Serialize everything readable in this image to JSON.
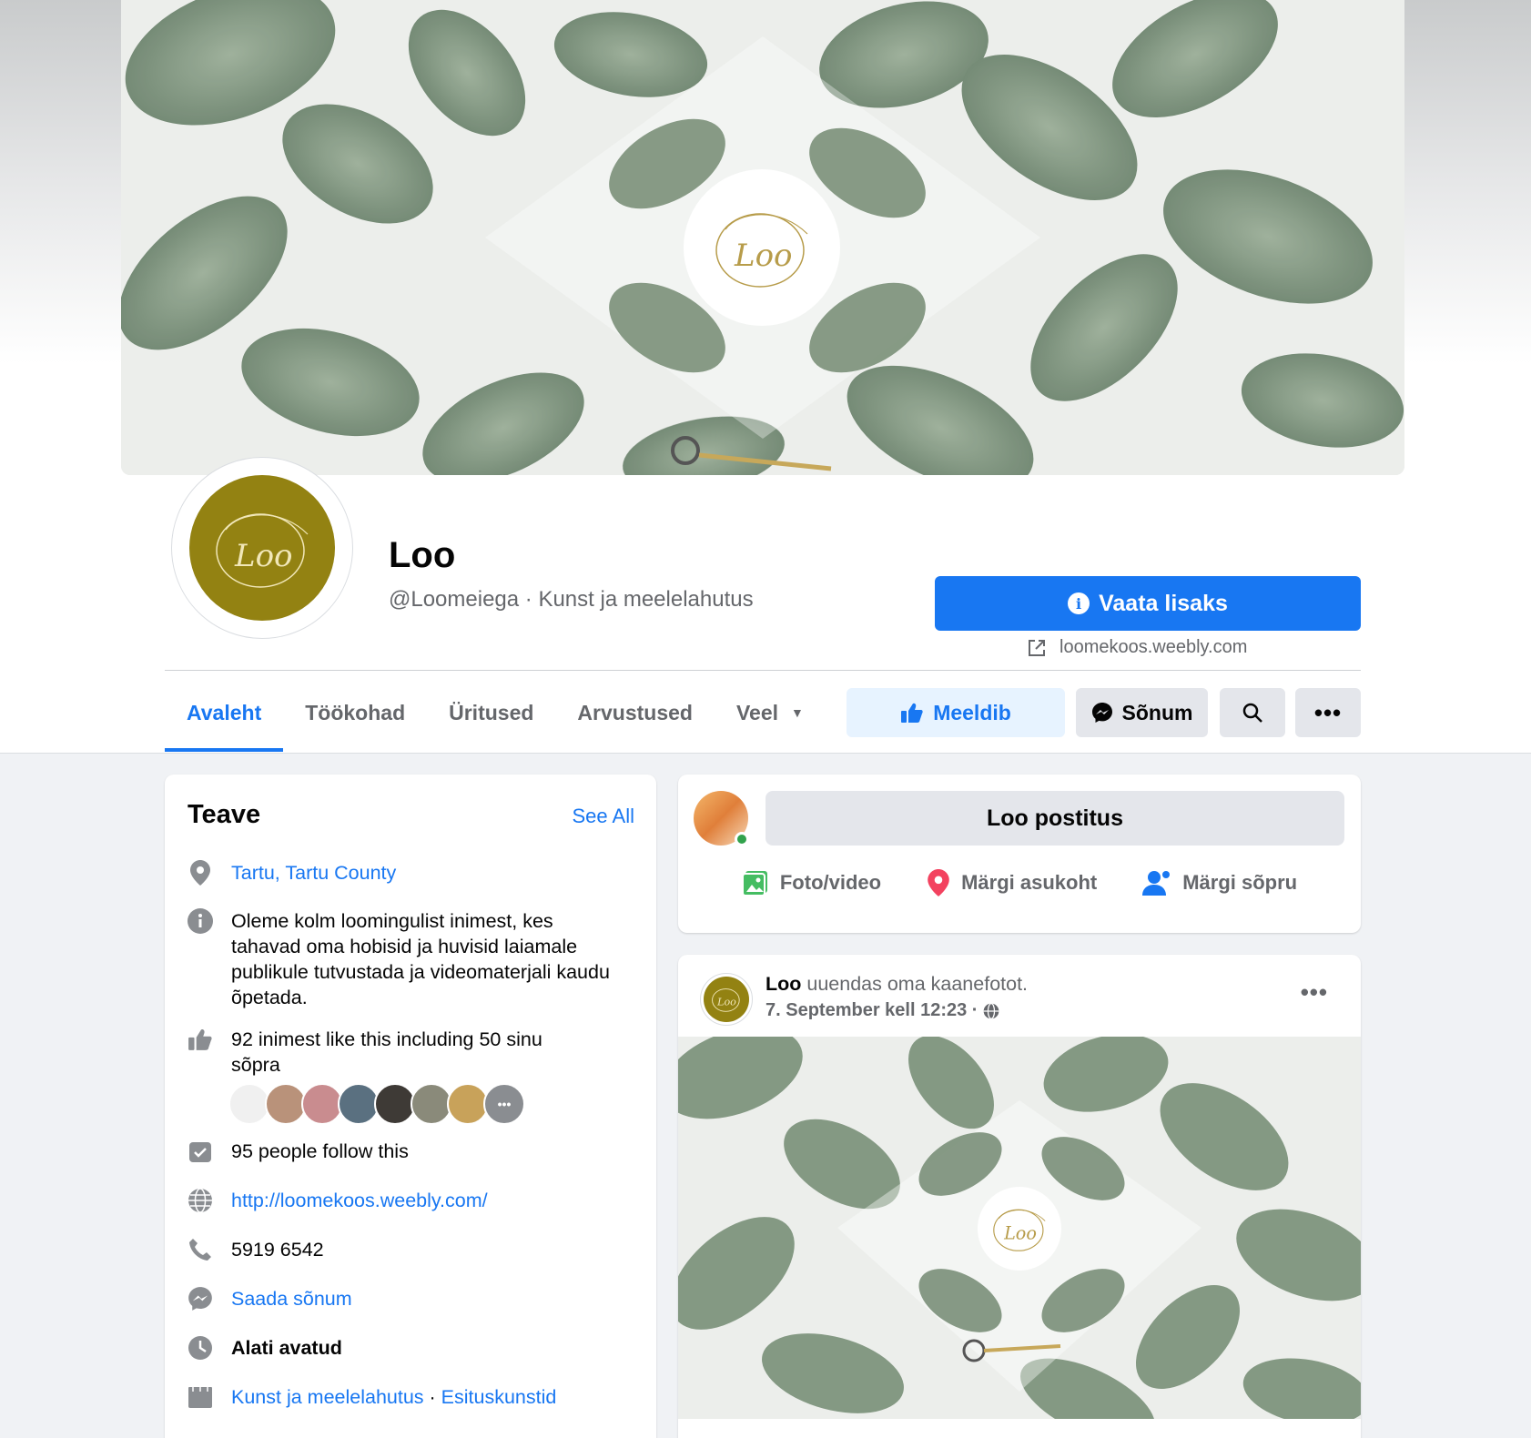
{
  "page": {
    "name": "Loo",
    "subtitle": "@Loomeiega · Kunst ja meelelahutus",
    "more_info_button": "Vaata lisaks",
    "website_short": "loomekoos.weebly.com"
  },
  "tabs": [
    {
      "label": "Avaleht",
      "active": true
    },
    {
      "label": "Töökohad"
    },
    {
      "label": "Üritused"
    },
    {
      "label": "Arvustused"
    },
    {
      "label": "Veel"
    }
  ],
  "actions": {
    "like": "Meeldib",
    "message": "Sõnum"
  },
  "about": {
    "title": "Teave",
    "see_all": "See All",
    "location": "Tartu, Tartu County",
    "description": "Oleme kolm loomingulist inimest, kes tahavad oma hobisid ja huvisid laiamale publikule tutvustada ja videomaterjali kaudu õpetada.",
    "likes": "92 inimest like this including 50 sinu sõpra",
    "follows": "95 people follow this",
    "website": "http://loomekoos.weebly.com/",
    "phone": "5919 6542",
    "send_message": "Saada sõnum",
    "hours": "Alati avatud",
    "category_1": "Kunst ja meelelahutus",
    "category_sep": " · ",
    "category_2": "Esituskunstid"
  },
  "create_post": {
    "button": "Loo postitus",
    "photo_video": "Foto/video",
    "check_in": "Märgi asukoht",
    "tag_friends": "Märgi sõpru"
  },
  "post": {
    "author": "Loo",
    "action": " uuendas oma kaanefotot.",
    "date": "7. September kell 12:23 ·"
  },
  "colors": {
    "accent": "#1877f2",
    "logo_gold": "#938212",
    "open_green": "#31a24c"
  }
}
